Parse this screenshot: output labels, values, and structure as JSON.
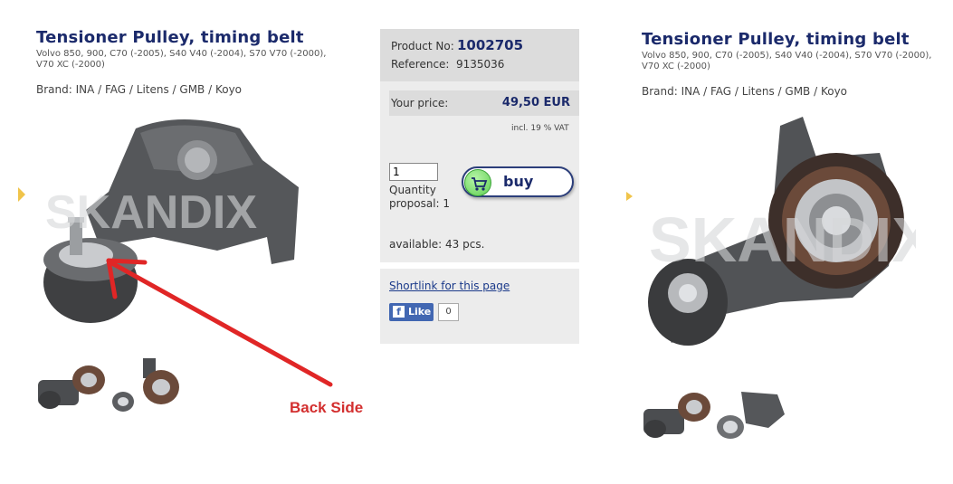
{
  "left": {
    "title": "Tensioner Pulley, timing belt",
    "subtitle": "Volvo 850, 900, C70 (-2005), S40 V40 (-2004), S70 V70 (-2000), V70 XC (-2000)",
    "brand": "Brand: INA / FAG / Litens / GMB / Koyo",
    "watermark": "SKANDIX",
    "annotation": "Back Side"
  },
  "middle": {
    "product_no_label": "Product No:",
    "product_no": "1002705",
    "reference_label": "Reference:",
    "reference": "9135036",
    "price_label": "Your price:",
    "price": "49,50 EUR",
    "vat": "incl. 19 % VAT",
    "quantity_value": "1",
    "quantity_proposal": "Quantity proposal: 1",
    "buy_label": "buy",
    "available": "available: 43 pcs.",
    "shortlink": "Shortlink for this page",
    "fb_like": "Like",
    "fb_count": "0"
  },
  "right": {
    "title": "Tensioner Pulley, timing belt",
    "subtitle": "Volvo 850, 900, C70 (-2005), S40 V40 (-2004), S70 V70 (-2000), V70 XC (-2000)",
    "brand": "Brand: INA / FAG / Litens / GMB / Koyo",
    "watermark": "SKANDIX"
  },
  "colors": {
    "title": "#1b2a6b",
    "annotation": "#d32f2f",
    "panel_bg": "#ececec",
    "fb_blue": "#4267b2"
  },
  "icons": [
    "cart-icon",
    "facebook-icon",
    "slide-arrow-icon"
  ]
}
